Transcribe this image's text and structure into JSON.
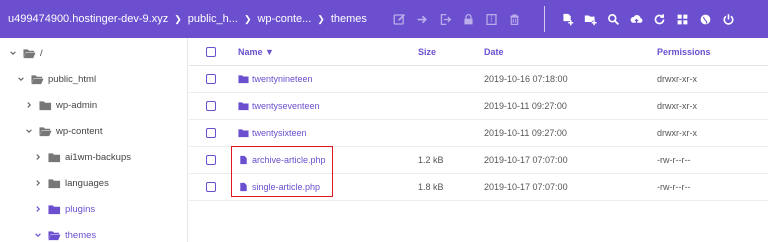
{
  "breadcrumb": [
    "u499474900.hostinger-dev-9.xyz",
    "public_h...",
    "wp-conte...",
    "themes"
  ],
  "toolbar": {
    "left_icons": [
      "edit-icon",
      "move-icon",
      "sign-out-icon",
      "lock-icon",
      "archive-icon",
      "trash-icon"
    ],
    "right_icons": [
      "new-file-icon",
      "new-folder-icon",
      "search-icon",
      "upload-icon",
      "refresh-icon",
      "grid-view-icon",
      "globe-icon",
      "power-icon"
    ]
  },
  "sidebar": {
    "items": [
      {
        "label": "/",
        "expanded": true,
        "level": 0
      },
      {
        "label": "public_html",
        "expanded": true,
        "level": 1
      },
      {
        "label": "wp-admin",
        "expanded": false,
        "level": 2
      },
      {
        "label": "wp-content",
        "expanded": true,
        "level": 2
      },
      {
        "label": "ai1wm-backups",
        "expanded": false,
        "level": 3
      },
      {
        "label": "languages",
        "expanded": false,
        "level": 3
      },
      {
        "label": "plugins",
        "expanded": false,
        "level": 3
      },
      {
        "label": "themes",
        "expanded": true,
        "level": 3
      }
    ]
  },
  "table": {
    "headers": {
      "name": "Name ▼",
      "size": "Size",
      "date": "Date",
      "permissions": "Permissions"
    },
    "rows": [
      {
        "type": "folder",
        "name": "twentynineteen",
        "size": "",
        "date": "2019-10-16 07:18:00",
        "permissions": "drwxr-xr-x"
      },
      {
        "type": "folder",
        "name": "twentyseventeen",
        "size": "",
        "date": "2019-10-11 09:27:00",
        "permissions": "drwxr-xr-x"
      },
      {
        "type": "folder",
        "name": "twentysixteen",
        "size": "",
        "date": "2019-10-11 09:27:00",
        "permissions": "drwxr-xr-x"
      },
      {
        "type": "file",
        "name": "archive-article.php",
        "size": "1.2 kB",
        "date": "2019-10-17 07:07:00",
        "permissions": "-rw-r--r--"
      },
      {
        "type": "file",
        "name": "single-article.php",
        "size": "1.8 kB",
        "date": "2019-10-17 07:07:00",
        "permissions": "-rw-r--r--"
      }
    ]
  },
  "colors": {
    "accent": "#6b4fcf",
    "highlight": "#e0161c"
  }
}
